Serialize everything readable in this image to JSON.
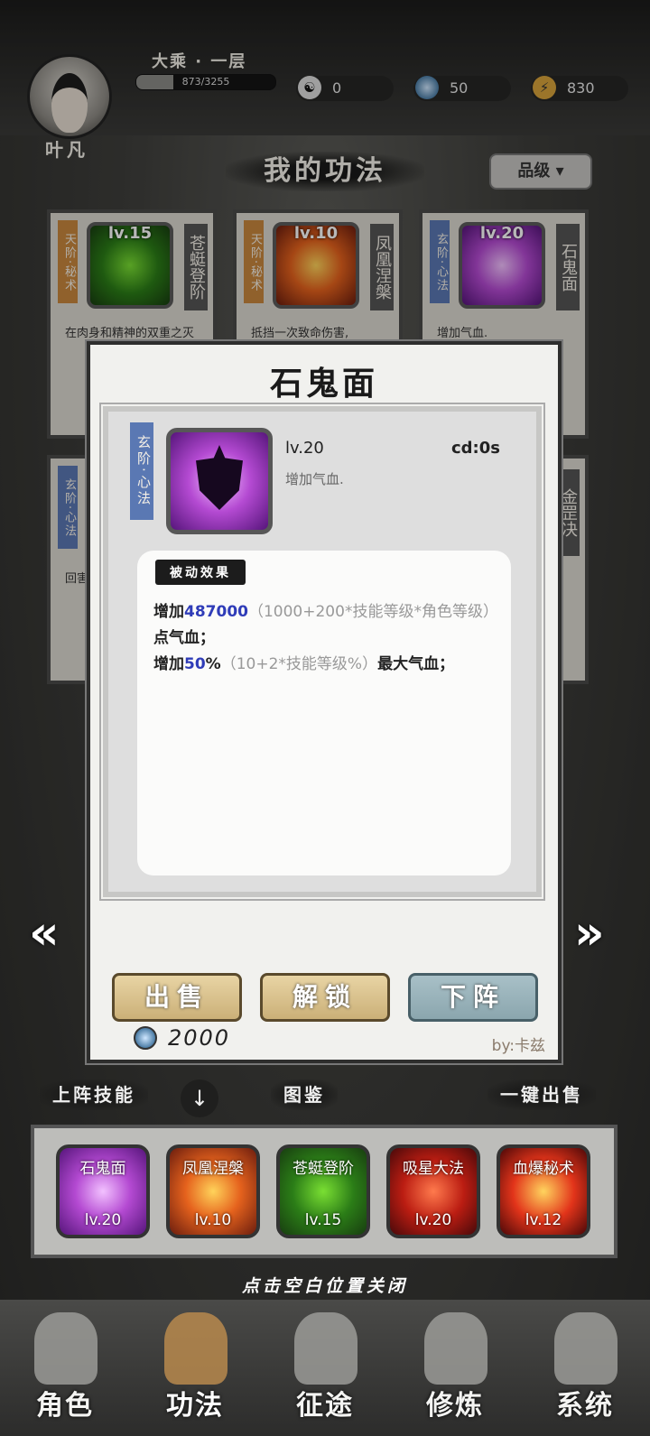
{
  "player": {
    "name": "叶凡",
    "realm": "大乘 · 一层",
    "xp_text": "873/3255",
    "xp_fraction": 0.268
  },
  "resources": [
    {
      "icon": "yin-yang-icon",
      "value": "0"
    },
    {
      "icon": "spirit-stone-icon",
      "value": "50"
    },
    {
      "icon": "lightning-icon",
      "value": "830"
    }
  ],
  "section_title": "我的功法",
  "grade_filter": "品级",
  "cards": [
    {
      "tag": "天阶·秘术",
      "lv": "lv.15",
      "name": "苍蜓登阶",
      "desc": "在肉身和精神的双重之灭"
    },
    {
      "tag": "天阶·秘术",
      "lv": "lv.10",
      "name": "凤凰涅槃",
      "desc": "抵挡一次致命伤害,"
    },
    {
      "tag": "玄阶·心法",
      "lv": "lv.20",
      "name": "石鬼面",
      "desc": "增加气血."
    },
    {
      "tag": "玄阶·心法",
      "lv": "",
      "name": "",
      "desc": "回害"
    },
    {
      "tag": "",
      "lv": "",
      "name": "金罡决",
      "desc": ""
    }
  ],
  "modal": {
    "title": "石鬼面",
    "tag": "玄阶·心法",
    "lv": "lv.20",
    "cd": "cd:0s",
    "subtitle": "增加气血.",
    "effect_label": "被动效果",
    "line1_prefix": "增加",
    "line1_num": "487000",
    "line1_formula": "（1000+200*技能等级*角色等级）",
    "line1_suffix": "点气血；",
    "line2_prefix": "增加",
    "line2_num": "50",
    "line2_unit": "%",
    "line2_formula": "（10+2*技能等级%）",
    "line2_suffix": "最大气血；",
    "btn_sell": "出售",
    "btn_unlock": "解锁",
    "btn_unequip": "下阵",
    "price": "2000",
    "author": "by:卡兹"
  },
  "arrows": {
    "prev": "«",
    "next": "»"
  },
  "lower": {
    "equipped_label": "上阵技能",
    "codex_label": "图鉴",
    "quick_sell_label": "一键出售",
    "down_icon": "↓"
  },
  "equipped": [
    {
      "name": "石鬼面",
      "lv": "lv.20"
    },
    {
      "name": "凤凰涅槃",
      "lv": "lv.10"
    },
    {
      "name": "苍蜓登阶",
      "lv": "lv.15"
    },
    {
      "name": "吸星大法",
      "lv": "lv.20"
    },
    {
      "name": "血爆秘术",
      "lv": "lv.12"
    }
  ],
  "close_hint": "点击空白位置关闭",
  "nav": [
    {
      "label": "角色"
    },
    {
      "label": "功法"
    },
    {
      "label": "征途"
    },
    {
      "label": "修炼"
    },
    {
      "label": "系统"
    }
  ],
  "colors": {
    "accent_gold": "#cbb078",
    "accent_blue": "#2f3cb8",
    "tag_tian": "#c8873e",
    "tag_xuan": "#5a78b3"
  }
}
